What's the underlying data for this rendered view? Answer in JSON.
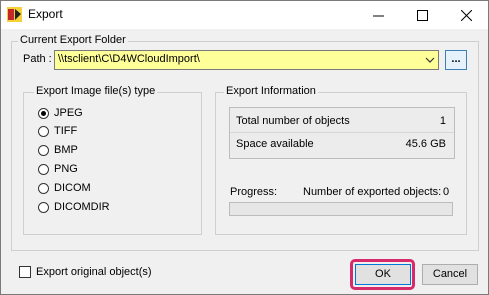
{
  "window": {
    "title": "Export"
  },
  "folder": {
    "group_title": "Current Export Folder",
    "path_label": "Path :",
    "path_value": "\\\\tsclient\\C\\D4WCloudImport\\",
    "browse_label": "..."
  },
  "image_type": {
    "group_title": "Export Image file(s) type",
    "options": [
      {
        "label": "JPEG",
        "selected": true
      },
      {
        "label": "TIFF",
        "selected": false
      },
      {
        "label": "BMP",
        "selected": false
      },
      {
        "label": "PNG",
        "selected": false
      },
      {
        "label": "DICOM",
        "selected": false
      },
      {
        "label": "DICOMDIR",
        "selected": false
      }
    ]
  },
  "export_info": {
    "group_title": "Export Information",
    "total_label": "Total number of objects",
    "total_value": "1",
    "space_label": "Space available",
    "space_value": "45.6 GB",
    "progress_label": "Progress:",
    "exported_label": "Number of exported objects:",
    "exported_value": "0",
    "progress_fraction": 0
  },
  "export_original": {
    "label": "Export original object(s)",
    "checked": false
  },
  "buttons": {
    "ok": "OK",
    "cancel": "Cancel"
  },
  "colors": {
    "path_background": "#ffff99",
    "ok_highlight": "#d62a6a",
    "primary_border": "#0078d7"
  }
}
